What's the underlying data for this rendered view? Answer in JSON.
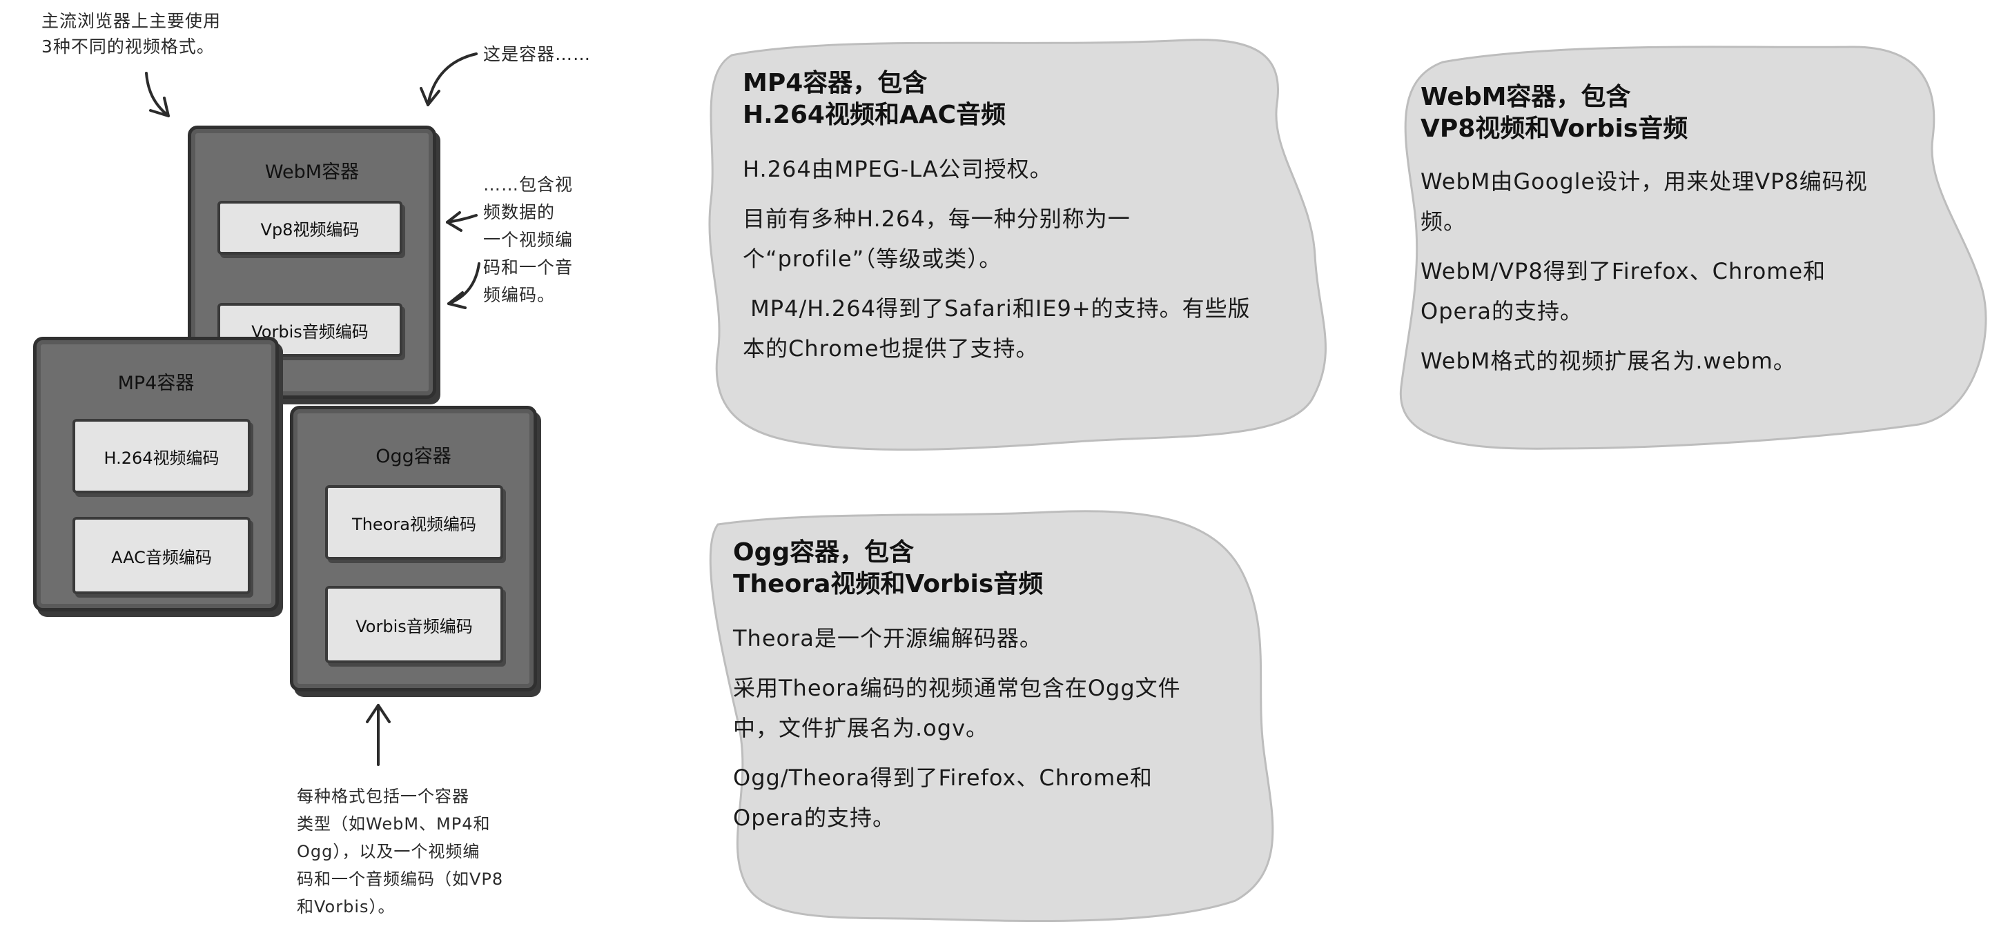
{
  "annotations": {
    "top_left": [
      "主流浏览器上主要使用",
      "3种不同的视频格式。"
    ],
    "container_pointer": "这是容器……",
    "codec_pointer": [
      "……包含视",
      "频数据的",
      "一个视频编",
      "码和一个音",
      "频编码。"
    ],
    "bottom": [
      "每种格式包括一个容器",
      "类型（如WebM、MP4和",
      "Ogg），以及一个视频编",
      "码和一个音频编码（如VP8",
      "和Vorbis）。"
    ]
  },
  "containers": {
    "webm": {
      "title": "WebM容器",
      "video": "Vp8视频编码",
      "audio": "Vorbis音频编码"
    },
    "mp4": {
      "title": "MP4容器",
      "video": "H.264视频编码",
      "audio": "AAC音频编码"
    },
    "ogg": {
      "title": "Ogg容器",
      "video": "Theora视频编码",
      "audio": "Vorbis音频编码"
    }
  },
  "blobs": {
    "mp4": {
      "heading": [
        "MP4容器，包含",
        "H.264视频和AAC音频"
      ],
      "paragraphs": [
        "H.264由MPEG-LA公司授权。",
        "目前有多种H.264，每一种分别称为一个“profile”（等级或类）。",
        " MP4/H.264得到了Safari和IE9+的支持。有些版本的Chrome也提供了支持。"
      ]
    },
    "webm": {
      "heading": [
        "WebM容器，包含",
        "VP8视频和Vorbis音频"
      ],
      "paragraphs": [
        "WebM由Google设计，用来处理VP8编码视频。",
        "WebM/VP8得到了Firefox、Chrome和Opera的支持。",
        "WebM格式的视频扩展名为.webm。"
      ]
    },
    "ogg": {
      "heading": [
        "Ogg容器，包含",
        "Theora视频和Vorbis音频"
      ],
      "paragraphs": [
        "Theora是一个开源编解码器。",
        "采用Theora编码的视频通常包含在Ogg文件中，文件扩展名为.ogv。",
        "Ogg/Theora得到了Firefox、Chrome和Opera的支持。"
      ]
    }
  }
}
